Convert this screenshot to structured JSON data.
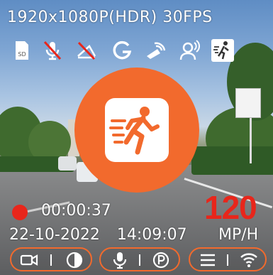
{
  "status": {
    "resolution": "1920x1080P(HDR) 30FPS",
    "recording_time": "00:00:37",
    "date": "22-10-2022",
    "time": "14:09:07",
    "speed": "120",
    "speed_unit": "MP/H"
  },
  "status_icons": [
    "sd-card-icon",
    "mic-muted-icon",
    "parking-off-icon",
    "g-sensor-icon",
    "speed-camera-icon",
    "voice-control-icon",
    "motion-detection-icon"
  ],
  "center_icon": "motion-detection-icon",
  "controls": {
    "left": [
      "video-camera-icon",
      "contrast-icon"
    ],
    "middle": [
      "microphone-icon",
      "parking-icon"
    ],
    "right": [
      "menu-icon",
      "wifi-icon"
    ]
  },
  "colors": {
    "accent": "#f26a2d",
    "record": "#e8261b",
    "speed": "#e8261b",
    "text": "#ffffff"
  }
}
